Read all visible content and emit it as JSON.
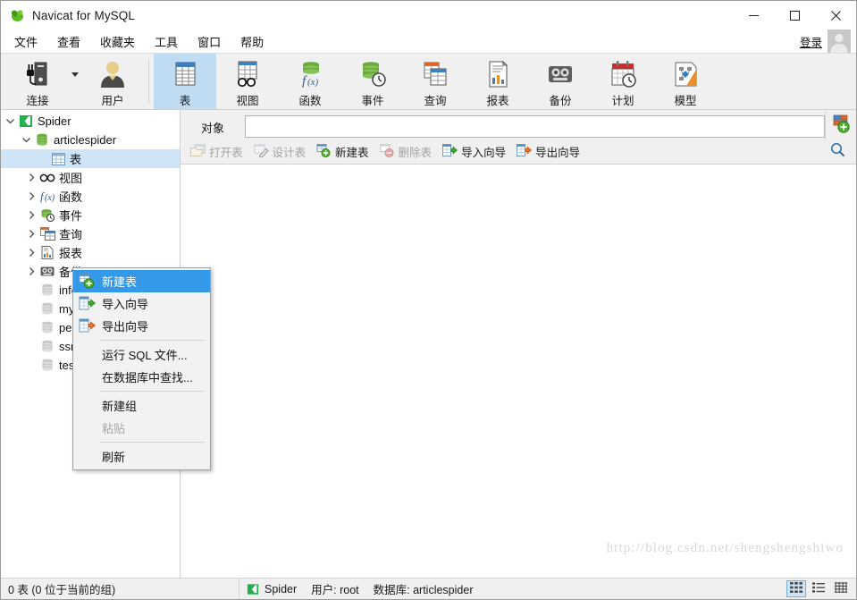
{
  "window": {
    "title": "Navicat for MySQL",
    "logo_icon": "navicat-logo-icon",
    "minimize_label": "─",
    "maximize_label": "□",
    "close_label": "✕"
  },
  "menubar": {
    "items": [
      {
        "label": "文件"
      },
      {
        "label": "查看"
      },
      {
        "label": "收藏夹"
      },
      {
        "label": "工具"
      },
      {
        "label": "窗口"
      },
      {
        "label": "帮助"
      }
    ],
    "login_label": "登录",
    "avatar_icon": "user-avatar-icon"
  },
  "toolbar": {
    "items": [
      {
        "label": "连接",
        "icon": "connection-icon",
        "selected": false,
        "has_caret": true
      },
      {
        "label": "用户",
        "icon": "user-icon",
        "selected": false,
        "has_caret": false
      },
      {
        "label": "表",
        "icon": "table-icon",
        "selected": true,
        "has_caret": false
      },
      {
        "label": "视图",
        "icon": "view-icon",
        "selected": false,
        "has_caret": false
      },
      {
        "label": "函数",
        "icon": "function-icon",
        "selected": false,
        "has_caret": false
      },
      {
        "label": "事件",
        "icon": "event-icon",
        "selected": false,
        "has_caret": false
      },
      {
        "label": "查询",
        "icon": "query-icon",
        "selected": false,
        "has_caret": false
      },
      {
        "label": "报表",
        "icon": "report-icon",
        "selected": false,
        "has_caret": false
      },
      {
        "label": "备份",
        "icon": "backup-icon",
        "selected": false,
        "has_caret": false
      },
      {
        "label": "计划",
        "icon": "schedule-icon",
        "selected": false,
        "has_caret": false
      },
      {
        "label": "模型",
        "icon": "model-icon",
        "selected": false,
        "has_caret": false
      }
    ]
  },
  "sidebar": {
    "nodes": [
      {
        "label": "Spider",
        "icon": "connection-node-icon",
        "indent": 0,
        "twisty": "expanded",
        "selected": false
      },
      {
        "label": "articlespider",
        "icon": "database-icon",
        "indent": 1,
        "twisty": "expanded",
        "selected": false
      },
      {
        "label": "表",
        "icon": "tables-folder-icon",
        "indent": 2,
        "twisty": "none",
        "selected": true
      },
      {
        "label": "视图",
        "icon": "views-folder-icon",
        "indent": 2,
        "twisty": "collapsed",
        "selected": false
      },
      {
        "label": "函数",
        "icon": "functions-folder-icon",
        "indent": 2,
        "twisty": "collapsed",
        "selected": false
      },
      {
        "label": "事件",
        "icon": "events-folder-icon",
        "indent": 2,
        "twisty": "collapsed",
        "selected": false
      },
      {
        "label": "查询",
        "icon": "queries-folder-icon",
        "indent": 2,
        "twisty": "collapsed",
        "selected": false
      },
      {
        "label": "报表",
        "icon": "reports-folder-icon",
        "indent": 2,
        "twisty": "collapsed",
        "selected": false
      },
      {
        "label": "备份",
        "icon": "backups-folder-icon",
        "indent": 2,
        "twisty": "collapsed",
        "selected": false
      },
      {
        "label": "information_schema",
        "icon": "database-icon",
        "indent": 1,
        "twisty": "none",
        "selected": false
      },
      {
        "label": "mysql",
        "icon": "database-icon",
        "indent": 1,
        "twisty": "none",
        "selected": false
      },
      {
        "label": "performance_schema",
        "icon": "database-icon",
        "indent": 1,
        "twisty": "none",
        "selected": false
      },
      {
        "label": "ssm",
        "icon": "database-icon",
        "indent": 1,
        "twisty": "none",
        "selected": false
      },
      {
        "label": "test",
        "icon": "database-icon",
        "indent": 1,
        "twisty": "none",
        "selected": false
      }
    ]
  },
  "objectbar": {
    "tab_label": "对象",
    "address_value": "",
    "add_icon": "add-object-icon"
  },
  "actionbar": {
    "buttons": [
      {
        "label": "打开表",
        "icon": "open-table-icon",
        "disabled": true
      },
      {
        "label": "设计表",
        "icon": "design-table-icon",
        "disabled": true
      },
      {
        "label": "新建表",
        "icon": "new-table-icon",
        "disabled": false
      },
      {
        "label": "删除表",
        "icon": "delete-table-icon",
        "disabled": true
      },
      {
        "label": "导入向导",
        "icon": "import-wizard-icon",
        "disabled": false
      },
      {
        "label": "导出向导",
        "icon": "export-wizard-icon",
        "disabled": false
      }
    ],
    "search_icon": "search-icon"
  },
  "contextmenu": {
    "items": [
      {
        "label": "新建表",
        "icon": "new-table-icon",
        "highlighted": true,
        "disabled": false,
        "separator_after": false
      },
      {
        "label": "导入向导",
        "icon": "import-wizard-icon",
        "highlighted": false,
        "disabled": false,
        "separator_after": false
      },
      {
        "label": "导出向导",
        "icon": "export-wizard-icon",
        "highlighted": false,
        "disabled": false,
        "separator_after": true
      },
      {
        "label": "运行 SQL 文件...",
        "icon": "none",
        "highlighted": false,
        "disabled": false,
        "separator_after": false
      },
      {
        "label": "在数据库中查找...",
        "icon": "none",
        "highlighted": false,
        "disabled": false,
        "separator_after": true
      },
      {
        "label": "新建组",
        "icon": "none",
        "highlighted": false,
        "disabled": false,
        "separator_after": false
      },
      {
        "label": "粘贴",
        "icon": "none",
        "highlighted": false,
        "disabled": true,
        "separator_after": true
      },
      {
        "label": "刷新",
        "icon": "none",
        "highlighted": false,
        "disabled": false,
        "separator_after": false
      }
    ]
  },
  "statusbar": {
    "count_text": "0 表 (0 位于当前的组)",
    "connection_icon": "connection-node-icon",
    "connection_name": "Spider",
    "user_text": "用户: root",
    "database_text": "数据库: articlespider",
    "view_modes": [
      {
        "name": "grid-view",
        "icon": "grid-view-icon",
        "selected": true
      },
      {
        "name": "list-view",
        "icon": "list-view-icon",
        "selected": false
      },
      {
        "name": "detail-view",
        "icon": "detail-view-icon",
        "selected": false
      }
    ]
  },
  "watermark": {
    "text": "http://blog.csdn.net/shengshengshiwo"
  },
  "colors": {
    "accent": "#3399e8",
    "selection": "#cfe4f7",
    "toolbar_selected": "#bfdcf2",
    "chrome": "#f0f0f0",
    "green": "#5aaa32",
    "orange": "#e87722"
  }
}
